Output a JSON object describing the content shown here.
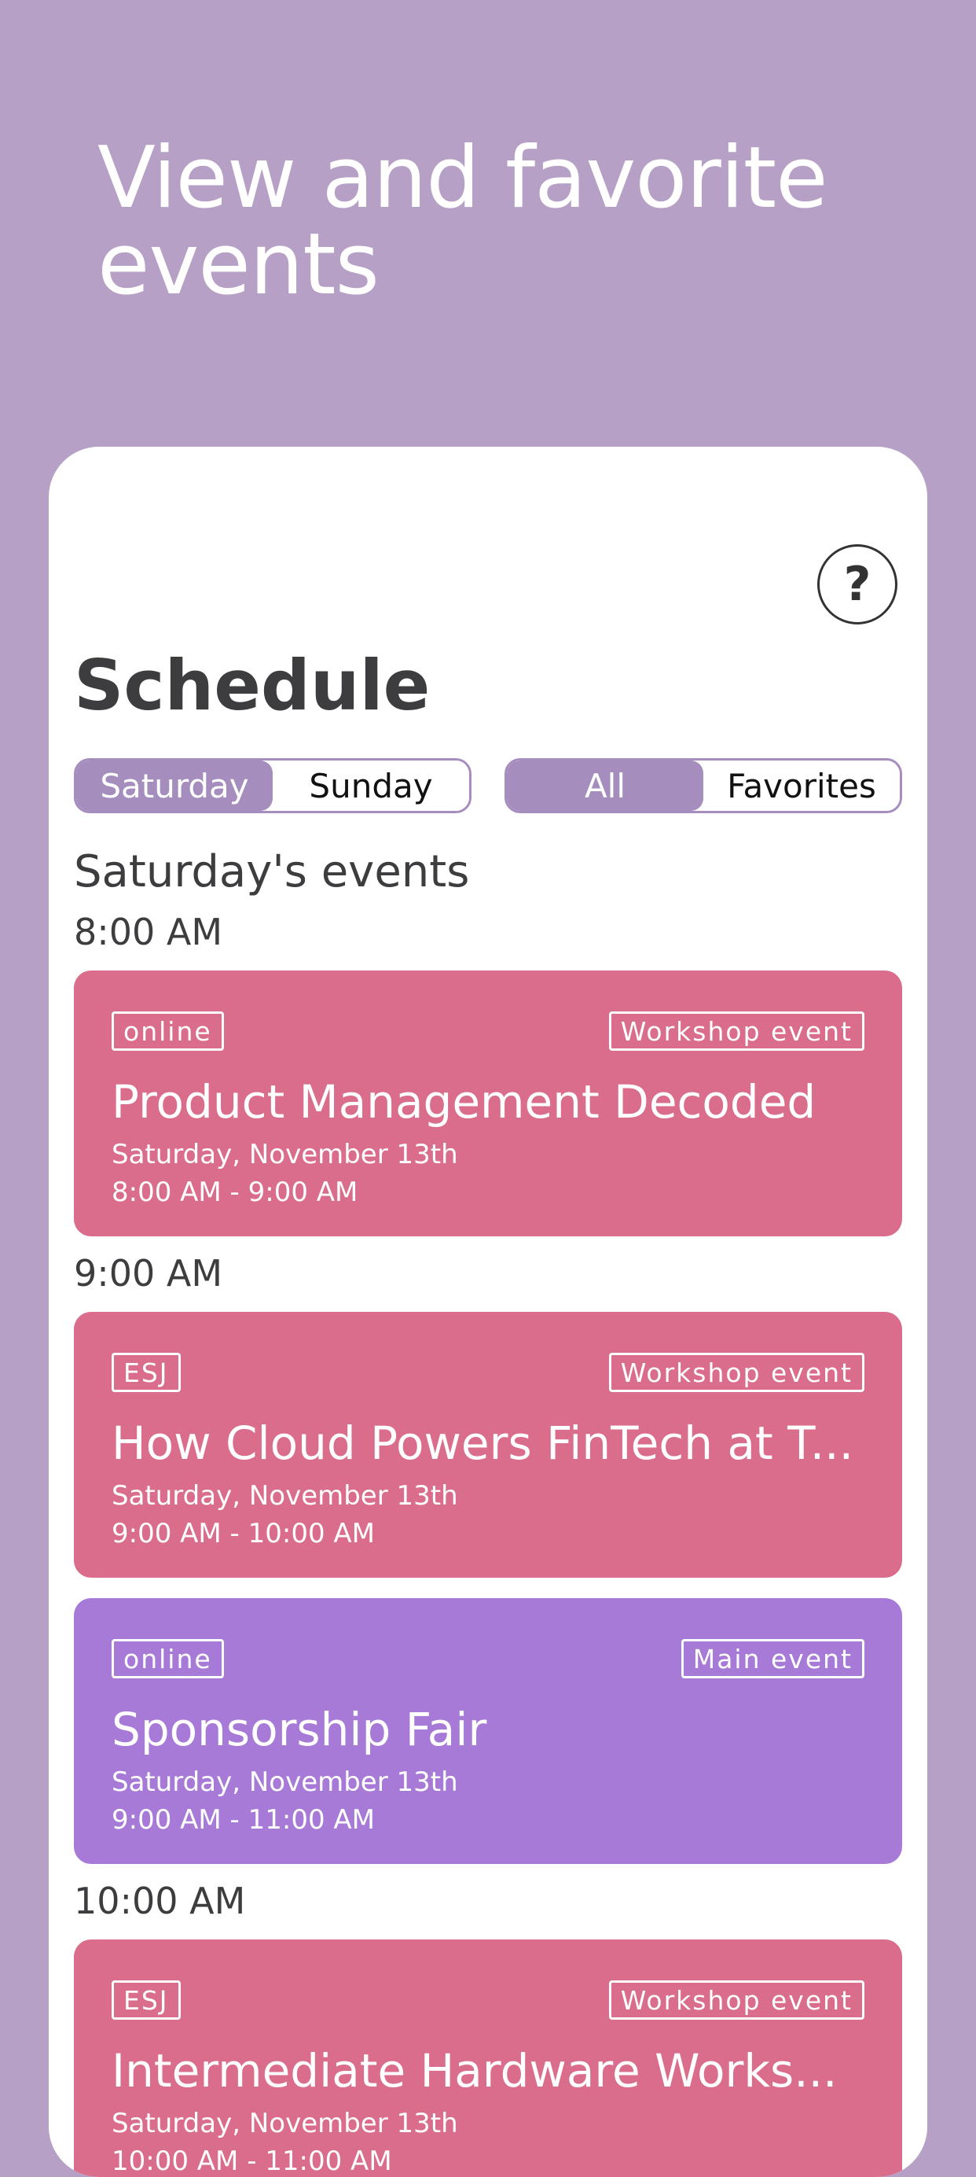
{
  "hero": {
    "title": "View and favorite events"
  },
  "schedule": {
    "title": "Schedule",
    "help_label": "?",
    "day_tabs": [
      {
        "label": "Saturday",
        "selected": true
      },
      {
        "label": "Sunday",
        "selected": false
      }
    ],
    "filter_tabs": [
      {
        "label": "All",
        "selected": true
      },
      {
        "label": "Favorites",
        "selected": false
      }
    ],
    "section_heading": "Saturday's events",
    "time_groups": [
      {
        "time": "8:00 AM"
      },
      {
        "time": "9:00 AM"
      },
      {
        "time": "10:00 AM"
      }
    ],
    "events": [
      {
        "location_tag": "online",
        "type_tag": "Workshop event",
        "title": "Product Management Decoded",
        "date": "Saturday, November 13th",
        "time_range": "8:00 AM - 9:00 AM",
        "color": "#da6d8b"
      },
      {
        "location_tag": "ESJ",
        "type_tag": "Workshop event",
        "title": "How Cloud Powers FinTech at T...",
        "date": "Saturday, November 13th",
        "time_range": "9:00 AM - 10:00 AM",
        "color": "#da6d8b"
      },
      {
        "location_tag": "online",
        "type_tag": "Main event",
        "title": "Sponsorship Fair",
        "date": "Saturday, November 13th",
        "time_range": "9:00 AM - 11:00 AM",
        "color": "#a77ad7"
      },
      {
        "location_tag": "ESJ",
        "type_tag": "Workshop event",
        "title": "Intermediate Hardware Works...",
        "date": "Saturday, November 13th",
        "time_range": "10:00 AM - 11:00 AM",
        "color": "#da6d8b"
      }
    ]
  },
  "colors": {
    "background": "#b6a0c6",
    "accent": "#a58dbd",
    "workshop": "#da6d8b",
    "main_event": "#a77ad7"
  }
}
